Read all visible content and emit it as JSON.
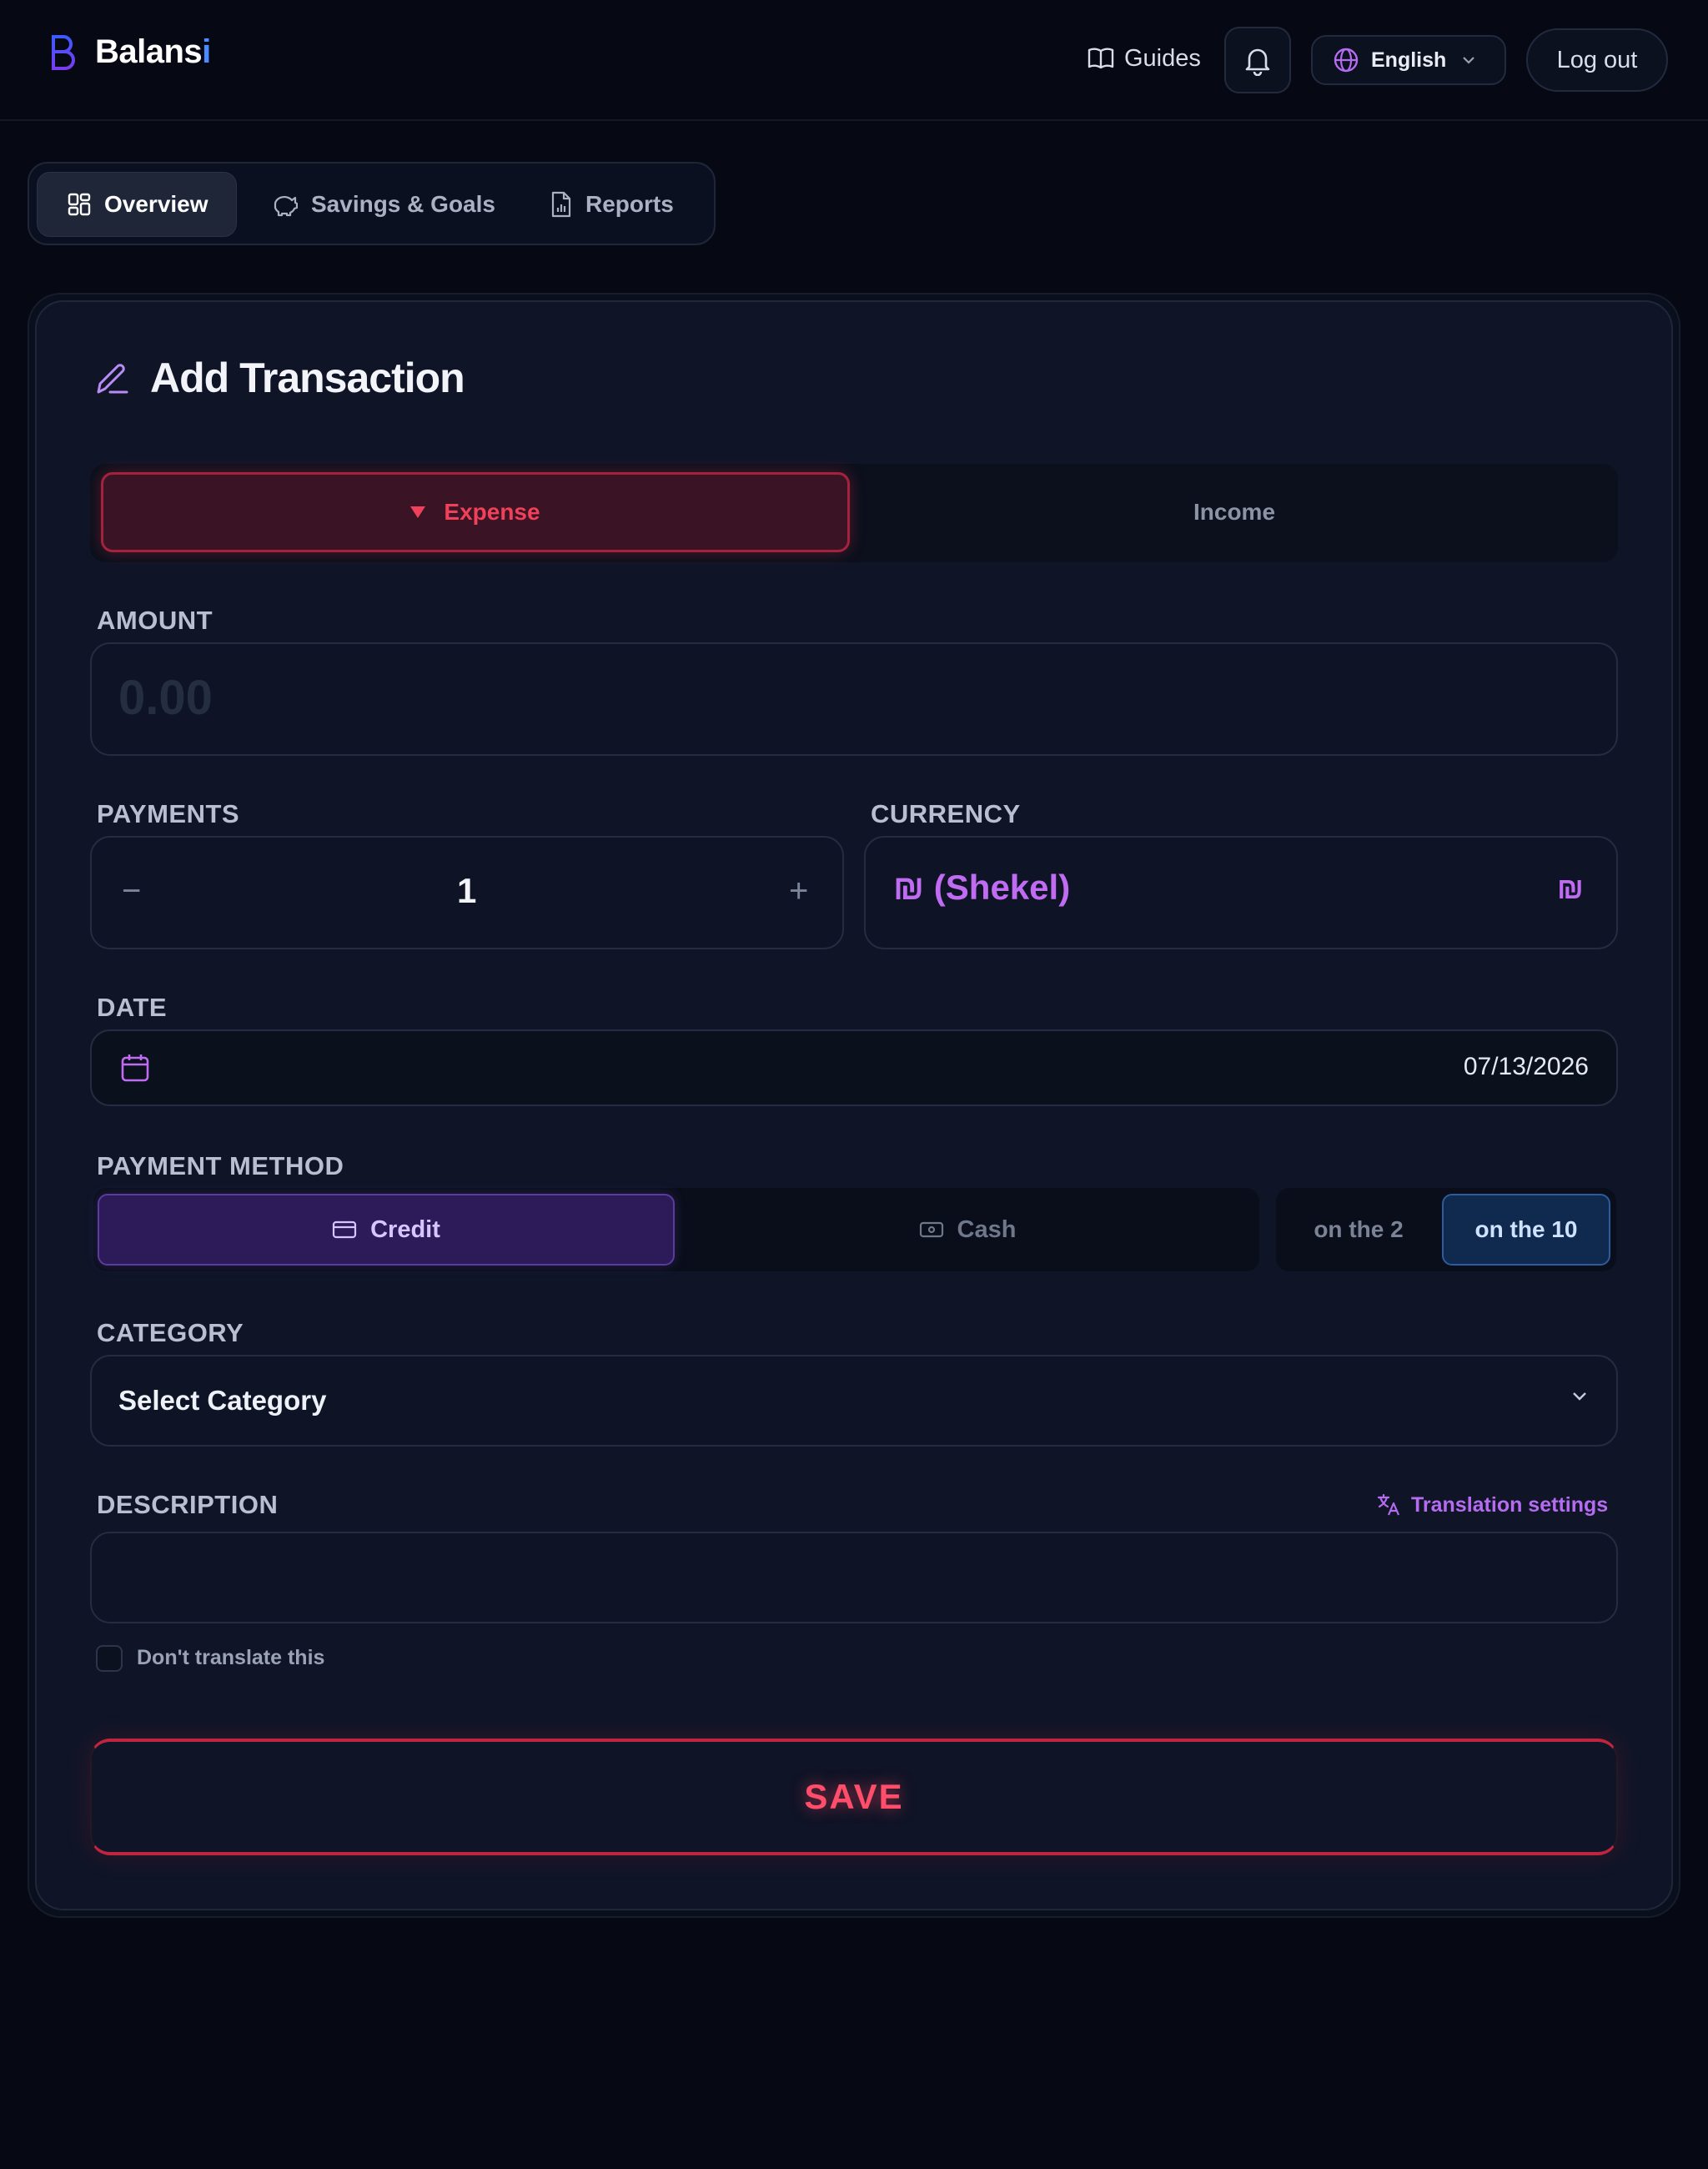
{
  "app": {
    "brand_main": "Balans",
    "brand_accent": "i"
  },
  "header": {
    "guides_label": "Guides",
    "language_label": "English",
    "logout_label": "Log out"
  },
  "tabs": [
    {
      "label": "Overview",
      "active": true
    },
    {
      "label": "Savings & Goals",
      "active": false
    },
    {
      "label": "Reports",
      "active": false
    }
  ],
  "form": {
    "title": "Add Transaction",
    "type_options": {
      "expense": "Expense",
      "income": "Income",
      "selected": "Expense"
    },
    "amount": {
      "label": "AMOUNT",
      "placeholder": "0.00",
      "value": ""
    },
    "payments": {
      "label": "PAYMENTS",
      "value": "1",
      "minus": "−",
      "plus": "+"
    },
    "currency": {
      "label": "CURRENCY",
      "value": "₪ (Shekel)",
      "symbol": "₪"
    },
    "date": {
      "label": "DATE",
      "value": "07/13/2026"
    },
    "payment_method": {
      "label": "PAYMENT METHOD",
      "credit": "Credit",
      "cash": "Cash",
      "selected": "Credit",
      "billing_options": [
        "on the 2",
        "on the 10"
      ],
      "billing_selected": "on the 10"
    },
    "category": {
      "label": "CATEGORY",
      "value": "Select Category"
    },
    "description": {
      "label": "DESCRIPTION",
      "value": "",
      "translation_link": "Translation settings"
    },
    "dont_translate": {
      "label": "Don't translate this",
      "checked": false
    },
    "save_label": "SAVE"
  },
  "colors": {
    "background": "#060914",
    "card": "#0f1527",
    "expense_accent": "#f0405a",
    "credit_accent": "#2c1a59",
    "currency_accent": "#c06cf2",
    "cycle_accent": "#0f2a4e"
  }
}
